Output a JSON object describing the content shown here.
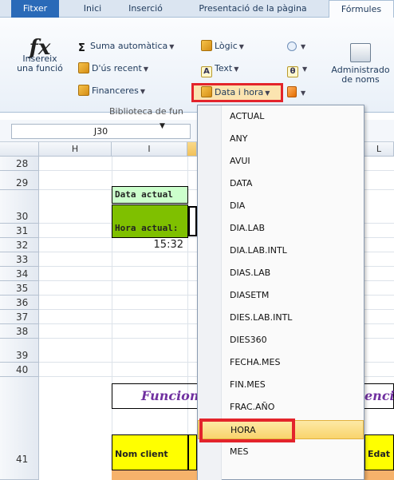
{
  "ribbon": {
    "tabs": [
      "Fitxer",
      "Inici",
      "Inserció",
      "Presentació de la pàgina",
      "Fórmules"
    ],
    "insert_function": {
      "line1": "Insereix",
      "line2": "una funció"
    },
    "autosum": "Suma automàtica",
    "recent": "D'ús recent",
    "financial": "Financeres",
    "logical": "Lògic",
    "text": "Text",
    "datetime": "Data i hora",
    "name_manager": {
      "line1": "Administrado",
      "line2": "de noms"
    },
    "group_label": "Biblioteca de fun"
  },
  "formula_bar": {
    "name_box": "J30"
  },
  "grid": {
    "columns": [
      "H",
      "I",
      "L"
    ],
    "rows": [
      "28",
      "29",
      "30",
      "31",
      "32",
      "33",
      "34",
      "35",
      "36",
      "37",
      "38",
      "39",
      "40",
      "41"
    ],
    "cells": {
      "data_actual": "Data actual",
      "hora_actual": "Hora actual:",
      "time_value": "15:32",
      "title_left": "Funcion",
      "title_right": "encia",
      "nom_client": "Nom client",
      "edat": "Edat"
    }
  },
  "menu": {
    "items": [
      "ACTUAL",
      "ANY",
      "AVUI",
      "DATA",
      "DIA",
      "DIA.LAB",
      "DIA.LAB.INTL",
      "DIAS.LAB",
      "DIASETM",
      "DIES.LAB.INTL",
      "DIES360",
      "FECHA.MES",
      "FIN.MES",
      "FRAC.AÑO",
      "HORA",
      "MES"
    ],
    "highlighted": "HORA"
  },
  "colors": {
    "accent_red": "#e3242b",
    "file_tab": "#2a6ab8",
    "cell_green_light": "#ccffcc",
    "cell_green_dark": "#7fc000",
    "cell_yellow": "#ffff00",
    "title_purple": "#7030a0"
  }
}
